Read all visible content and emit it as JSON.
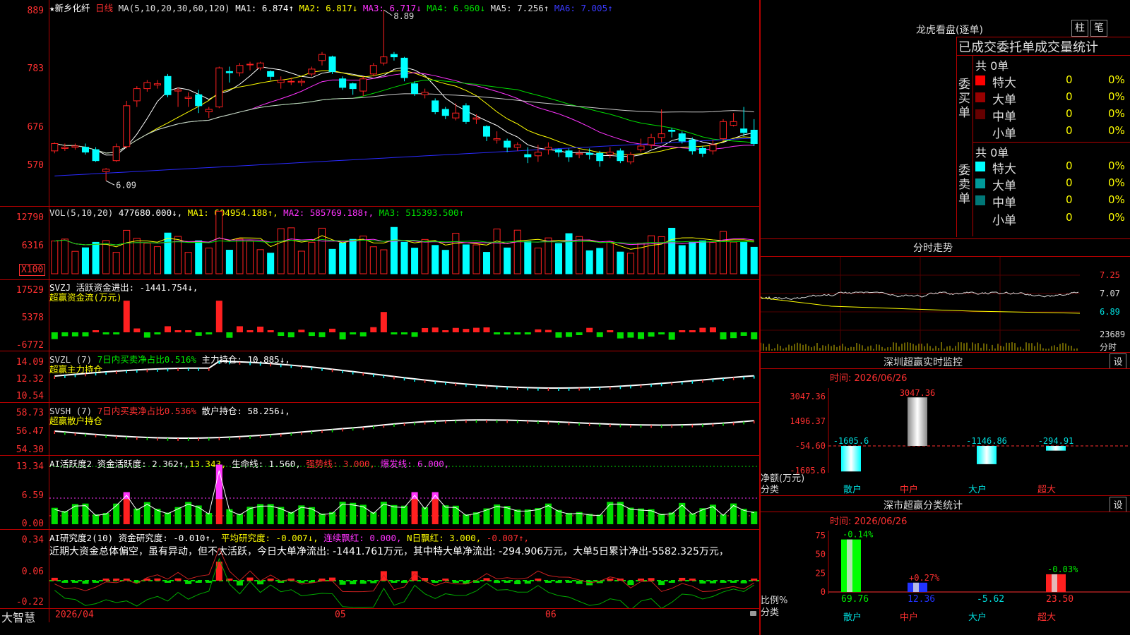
{
  "app": {
    "name": "大智慧"
  },
  "main": {
    "title_star": "★",
    "stock_name": "新乡化纤",
    "period": "日线",
    "ma_header": "MA(5,10,20,30,60,120)",
    "ma_items": [
      {
        "label": "MA1: 6.874↑",
        "color": "#ffffff"
      },
      {
        "label": "MA2: 6.817↓",
        "color": "#ffff00"
      },
      {
        "label": "MA3: 6.717↓",
        "color": "#ff33ff"
      },
      {
        "label": "MA4: 6.960↓",
        "color": "#00dd00"
      },
      {
        "label": "MA5: 7.256↑",
        "color": "#dddddd"
      },
      {
        "label": "MA6: 7.005↑",
        "color": "#3333ff"
      }
    ],
    "price_yticks": [
      "889",
      "783",
      "676",
      "570"
    ],
    "high_label": "8.89",
    "low_label": "6.09"
  },
  "volume": {
    "header": "VOL(5,10,20)",
    "value": "477680.000↓,",
    "ma_items": [
      {
        "label": "MA1: 604954.188↑,",
        "color": "#ffff00"
      },
      {
        "label": "MA2: 585769.188↑,",
        "color": "#ff33ff"
      },
      {
        "label": "MA3: 515393.500↑",
        "color": "#00dd00"
      }
    ],
    "yticks": [
      "12790",
      "6316"
    ],
    "unit": "X100"
  },
  "svzj": {
    "header": "SVZJ  活跃资金进出: -1441.754↓,",
    "subtitle": "超赢资金流(万元)",
    "yticks": [
      "17529",
      "5378",
      "-6772"
    ]
  },
  "svzl": {
    "header_a": "SVZL (7)",
    "header_b": "7日内买卖净占比0.516%",
    "header_c": "主力持仓: 10.885↓,",
    "subtitle": "超赢主力持仓",
    "yticks": [
      "14.09",
      "12.32",
      "10.54"
    ]
  },
  "svsh": {
    "header_a": "SVSH (7)",
    "header_b": "7日内买卖净占比0.536%",
    "header_c": "散户持仓: 58.256↓,",
    "subtitle": "超赢散户持仓",
    "yticks": [
      "58.73",
      "56.47",
      "54.30"
    ]
  },
  "ai_active": {
    "header_a": "AI活跃度2 资金活跃度: 2.362↑,",
    "header_b": "13.343,",
    "header_c": "生命线: 1.560,",
    "header_d": "强势线: 3.000,",
    "header_e": "爆发线: 6.000,",
    "yticks": [
      "13.34",
      "6.59",
      "0.00"
    ]
  },
  "ai_research": {
    "header_a": "AI研究度2(10) 资金研究度: -0.010↑,",
    "header_b": "平均研究度: -0.007↓,",
    "header_c": "连续飘红: 0.000,",
    "header_d": "N日飘红: 3.000,",
    "header_e": "-0.007↑,",
    "comment": "近期大资金总体偏空，虽有异动，但不太活跃，今日大单净流出: -1441.761万元，其中特大单净流出: -294.906万元，大单5日累计净出-5582.325万元，",
    "yticks": [
      "0.34",
      "0.06",
      "-0.22"
    ]
  },
  "x_axis": {
    "labels": [
      "2026/04",
      "05",
      "06"
    ]
  },
  "right": {
    "lhb_title": "龙虎看盘(逐单)",
    "btn_bar": "柱",
    "btn_pen": "笔",
    "stats_title": "已成交委托单成交量统计",
    "buy_side": "委买单",
    "sell_side": "委卖单",
    "buy_total": "共 0单",
    "sell_total": "共 0单",
    "buy_rows": [
      {
        "label": "特大",
        "count": "0",
        "pct": "0%",
        "color": "#ff0000"
      },
      {
        "label": "大单",
        "count": "0",
        "pct": "0%",
        "color": "#990000"
      },
      {
        "label": "中单",
        "count": "0",
        "pct": "0%",
        "color": "#660000"
      },
      {
        "label": "小单",
        "count": "0",
        "pct": "0%",
        "color": "#000000"
      }
    ],
    "sell_rows": [
      {
        "label": "特大",
        "count": "0",
        "pct": "0%",
        "color": "#00ffff"
      },
      {
        "label": "大单",
        "count": "0",
        "pct": "0%",
        "color": "#009999"
      },
      {
        "label": "中单",
        "count": "0",
        "pct": "0%",
        "color": "#007777"
      },
      {
        "label": "小单",
        "count": "0",
        "pct": "0%",
        "color": "#000000"
      }
    ],
    "fs_title": "分时走势",
    "fs_yticks": [
      "7.25",
      "7.07",
      "6.89"
    ],
    "fs_vol": "23689",
    "fs_label": "分时",
    "monitor_title": "深圳超赢实时监控",
    "monitor_btn": "设",
    "monitor_time": "时间: 2026/06/26",
    "monitor_yticks": [
      "3047.36",
      "1496.37",
      "-54.60",
      "-1605.6"
    ],
    "monitor_ylabel_a": "净额(万元)",
    "monitor_ylabel_b": "分类",
    "monitor_cats": [
      "散户",
      "中户",
      "大户",
      "超大"
    ],
    "monitor_values": [
      "-1605.6",
      "3047.36",
      "-1146.86",
      "-294.91"
    ],
    "class_title": "深市超赢分类统计",
    "class_btn": "设",
    "class_time": "时间: 2026/06/26",
    "class_yticks": [
      "75",
      "50",
      "25",
      "0"
    ],
    "class_ylabel_a": "比例%",
    "class_ylabel_b": "分类",
    "class_cats": [
      "散户",
      "中户",
      "大户",
      "超大"
    ],
    "class_top": [
      "-0.14%",
      "+0.27%",
      "",
      "-0.03%"
    ],
    "class_bottom": [
      "69.76",
      "12.36",
      "-5.62",
      "23.50"
    ]
  },
  "chart_data": [
    {
      "type": "candlestick",
      "title": "新乡化纤 日线",
      "ylim": [
        5.7,
        8.89
      ],
      "candles": [
        [
          6.58,
          6.7,
          6.72,
          6.54
        ],
        [
          6.62,
          6.64,
          6.7,
          6.58
        ],
        [
          6.64,
          6.66,
          6.7,
          6.6
        ],
        [
          6.64,
          6.56,
          6.7,
          6.52
        ],
        [
          6.6,
          6.42,
          6.64,
          6.4
        ],
        [
          6.24,
          6.28,
          6.3,
          6.09
        ],
        [
          6.42,
          6.65,
          6.7,
          6.4
        ],
        [
          6.65,
          7.32,
          7.4,
          6.62
        ],
        [
          7.4,
          7.6,
          7.64,
          7.3
        ],
        [
          7.6,
          7.7,
          7.74,
          7.55
        ],
        [
          7.66,
          7.68,
          7.74,
          7.6
        ],
        [
          7.8,
          7.5,
          7.84,
          7.46
        ],
        [
          7.56,
          7.58,
          7.62,
          7.3
        ],
        [
          7.44,
          7.46,
          7.54,
          7.3
        ],
        [
          7.5,
          7.32,
          7.58,
          7.2
        ],
        [
          7.22,
          7.26,
          7.3,
          7.12
        ],
        [
          7.3,
          7.94,
          7.96,
          7.28
        ],
        [
          7.88,
          7.86,
          7.96,
          7.7
        ],
        [
          7.86,
          7.98,
          8.02,
          7.8
        ],
        [
          8.0,
          8.0,
          8.04,
          7.9
        ],
        [
          7.94,
          8.02,
          8.04,
          7.9
        ],
        [
          7.88,
          7.8,
          7.9,
          7.74
        ],
        [
          7.7,
          7.74,
          7.8,
          7.6
        ],
        [
          7.72,
          7.72,
          7.78,
          7.66
        ],
        [
          7.7,
          7.72,
          7.76,
          7.64
        ],
        [
          7.84,
          7.92,
          7.96,
          7.8
        ],
        [
          8.06,
          8.16,
          8.2,
          7.98
        ],
        [
          8.12,
          7.88,
          8.14,
          7.84
        ],
        [
          7.76,
          7.62,
          7.8,
          7.58
        ],
        [
          7.68,
          7.6,
          7.7,
          7.5
        ],
        [
          7.56,
          7.76,
          7.8,
          7.48
        ],
        [
          7.84,
          7.98,
          8.02,
          7.8
        ],
        [
          8.02,
          8.12,
          8.89,
          7.98
        ],
        [
          8.16,
          8.12,
          8.2,
          8.06
        ],
        [
          8.1,
          7.78,
          8.12,
          7.72
        ],
        [
          7.68,
          7.52,
          7.72,
          7.48
        ],
        [
          7.5,
          7.54,
          7.6,
          7.44
        ],
        [
          7.4,
          7.22,
          7.44,
          7.18
        ],
        [
          7.26,
          7.16,
          7.3,
          7.1
        ],
        [
          7.12,
          7.2,
          7.36,
          7.08
        ],
        [
          7.32,
          7.06,
          7.36,
          7.02
        ],
        [
          7.1,
          7.12,
          7.18,
          7.02
        ],
        [
          6.98,
          6.82,
          7.0,
          6.74
        ],
        [
          6.76,
          6.78,
          6.9,
          6.7
        ],
        [
          6.74,
          6.64,
          6.78,
          6.56
        ],
        [
          6.64,
          6.68,
          6.72,
          6.58
        ],
        [
          6.52,
          6.48,
          6.64,
          6.38
        ],
        [
          6.5,
          6.56,
          6.68,
          6.4
        ],
        [
          6.6,
          6.64,
          6.72,
          6.52
        ],
        [
          6.6,
          6.56,
          6.62,
          6.48
        ],
        [
          6.58,
          6.48,
          6.62,
          6.4
        ],
        [
          6.52,
          6.54,
          6.6,
          6.46
        ],
        [
          6.54,
          6.52,
          6.62,
          6.44
        ],
        [
          6.54,
          6.42,
          6.58,
          6.32
        ],
        [
          6.52,
          6.56,
          6.64,
          6.46
        ],
        [
          6.58,
          6.42,
          6.62,
          6.38
        ],
        [
          6.4,
          6.52,
          6.56,
          6.36
        ],
        [
          6.6,
          6.66,
          6.78,
          6.56
        ],
        [
          6.68,
          6.8,
          6.86,
          6.62
        ],
        [
          6.8,
          6.86,
          7.26,
          6.72
        ],
        [
          6.92,
          6.9,
          6.96,
          6.8
        ],
        [
          6.86,
          6.74,
          6.9,
          6.7
        ],
        [
          6.76,
          6.58,
          6.8,
          6.52
        ],
        [
          6.62,
          6.54,
          6.66,
          6.48
        ],
        [
          6.58,
          6.68,
          6.76,
          6.52
        ],
        [
          6.78,
          7.06,
          7.1,
          6.74
        ],
        [
          7.0,
          7.06,
          7.2,
          6.98
        ],
        [
          6.94,
          6.88,
          7.3,
          6.82
        ],
        [
          6.92,
          6.7,
          7.1,
          6.66
        ]
      ]
    }
  ]
}
